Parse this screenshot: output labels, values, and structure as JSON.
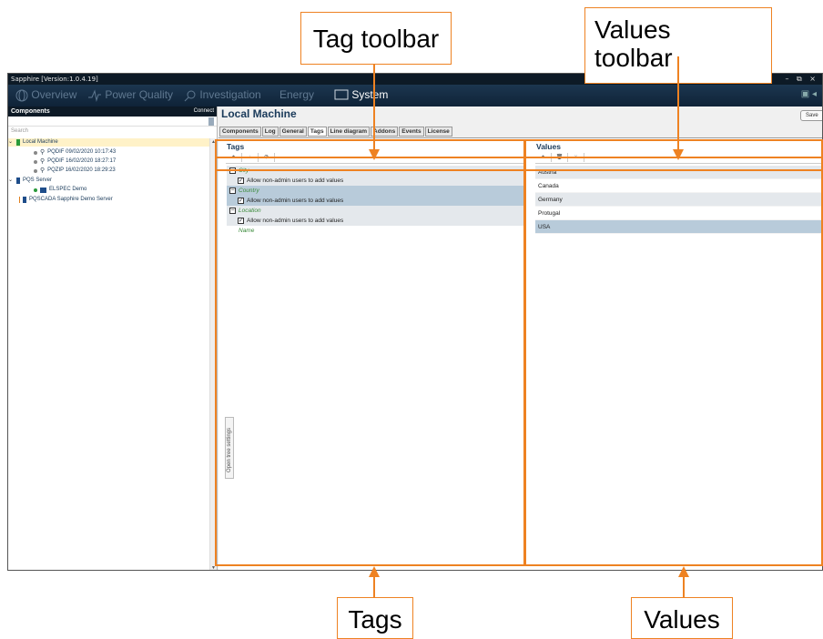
{
  "app": {
    "title": "Sapphire [Version:1.0.4.19]",
    "window_controls": "– ⧉ ×"
  },
  "nav": {
    "items": [
      {
        "label": "Overview",
        "icon": "globe-icon"
      },
      {
        "label": "Power Quality",
        "icon": "waveform-icon"
      },
      {
        "label": "Investigation",
        "icon": "magnifier-icon"
      },
      {
        "label": "Energy",
        "icon": "bolt-icon"
      },
      {
        "label": "System",
        "icon": "monitor-icon"
      }
    ],
    "active": "System"
  },
  "left_panel": {
    "title": "Components",
    "connect": "Connect",
    "search_placeholder": "Search",
    "tree": [
      {
        "label": "Local Machine",
        "icon": "server-icon"
      },
      {
        "label": "PQDIF 09/02/2020 10:17:43",
        "icon": "search-icon"
      },
      {
        "label": "PQDIF 16/02/2020 18:27:17",
        "icon": "search-icon"
      },
      {
        "label": "PQZIP 16/02/2020 18:29:23",
        "icon": "search-icon"
      },
      {
        "label": "PQS Server",
        "icon": "server-icon"
      },
      {
        "label": "ELSPEC Demo",
        "icon": "device-icon"
      },
      {
        "label": "PQSCADA Sapphire Demo Server",
        "icon": "server-icon"
      }
    ]
  },
  "main": {
    "title": "Local Machine",
    "save_label": "Save",
    "tabs": [
      "Components",
      "Log",
      "General",
      "Tags",
      "Line diagram",
      "Addons",
      "Events",
      "License"
    ],
    "active_tab": "Tags",
    "side_tab": "Open tree settings"
  },
  "tags_panel": {
    "title": "Tags",
    "toolbar": [
      "+",
      "↑",
      "⊘"
    ],
    "rows": [
      {
        "name": "City",
        "checkbox": "Allow non-admin users to add values"
      },
      {
        "name": "Country",
        "checkbox": "Allow non-admin users to add values"
      },
      {
        "name": "Location",
        "checkbox": "Allow non-admin users to add values"
      },
      {
        "name": "Name"
      }
    ]
  },
  "values_panel": {
    "title": "Values",
    "toolbar": [
      "+",
      "🗑",
      "✕"
    ],
    "values": [
      "Austria",
      "Canada",
      "Germany",
      "Protugal",
      "USA"
    ],
    "selected": "USA"
  },
  "annotations": {
    "tag_toolbar": "Tag toolbar",
    "values_toolbar_line1": "Values",
    "values_toolbar_line2": "toolbar",
    "tags": "Tags",
    "values": "Values",
    "color": "#ee8222"
  }
}
